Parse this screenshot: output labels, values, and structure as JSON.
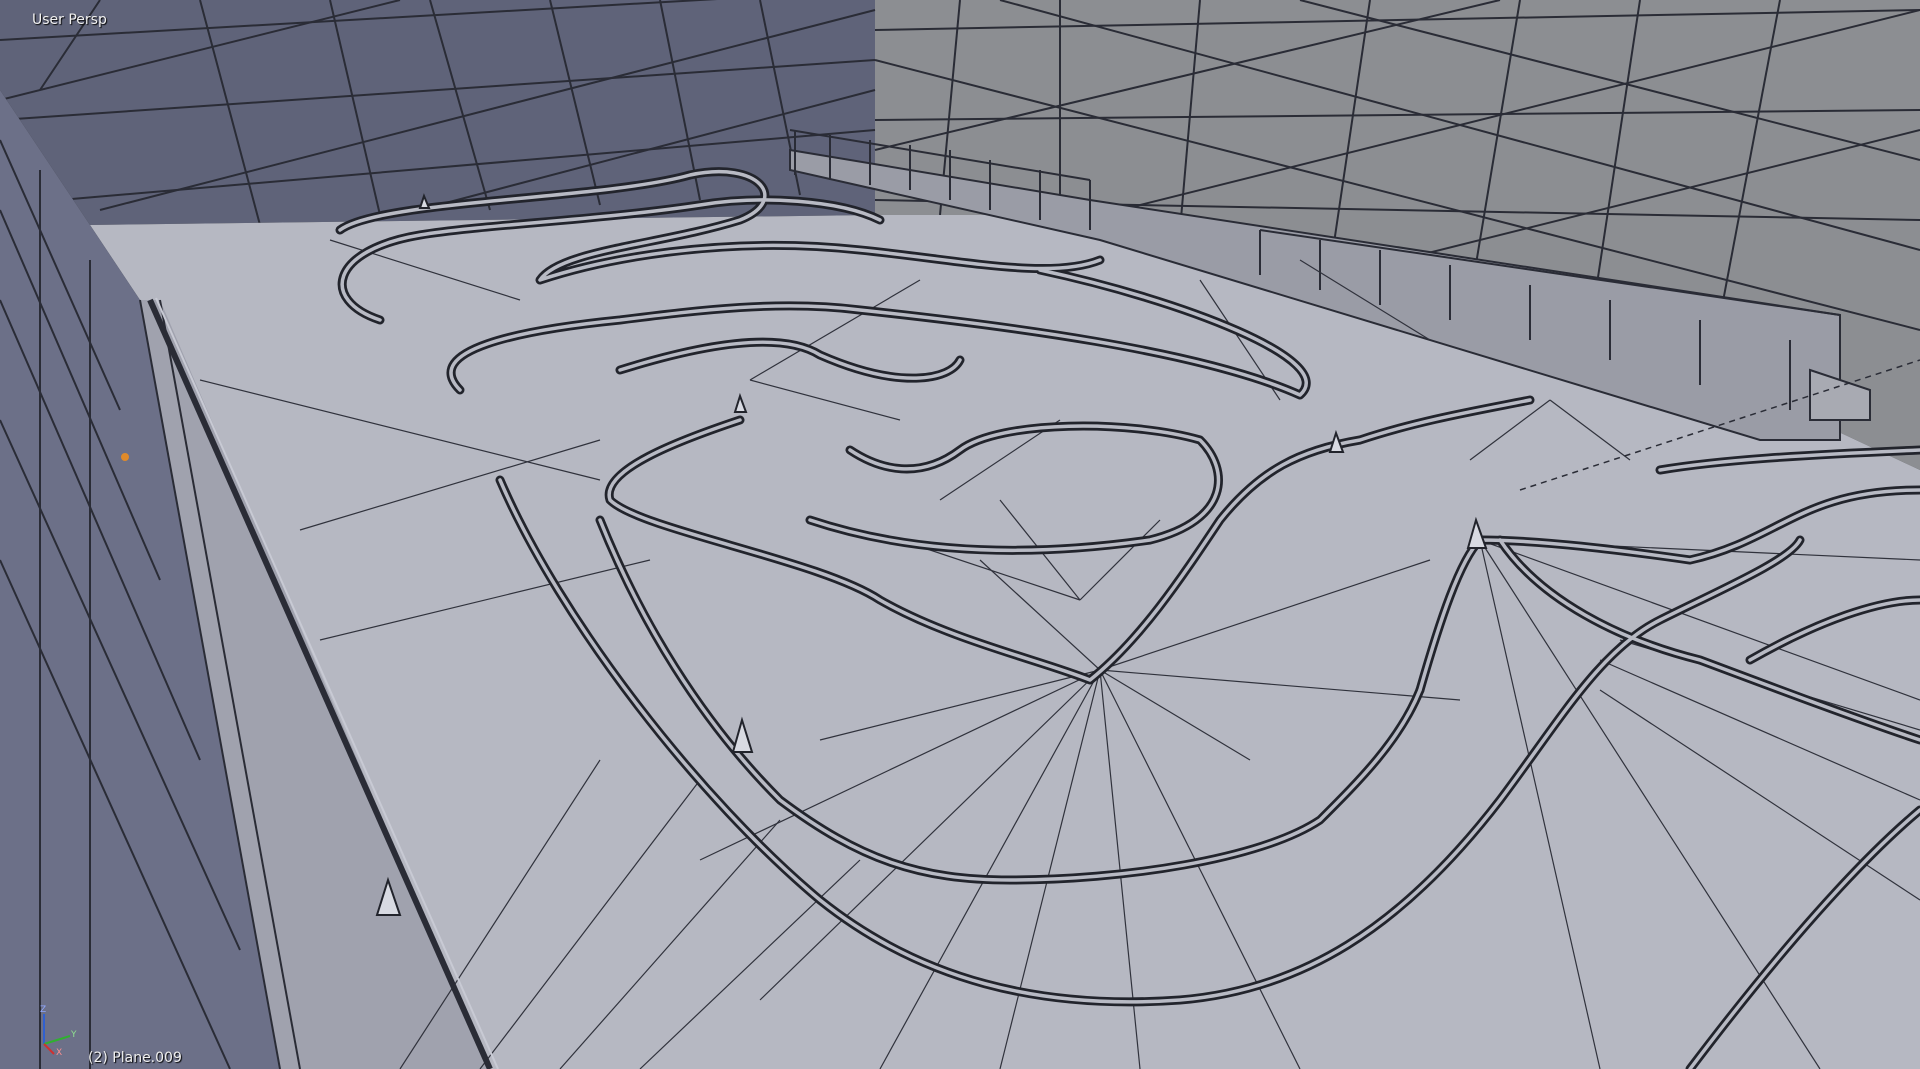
{
  "viewport": {
    "view_name": "User Persp",
    "object_info": "(2) Plane.009",
    "axis_gizmo_icon": "xyz-axis-gizmo-icon",
    "axis_labels": {
      "z": "Z",
      "y": "Y",
      "x": "X"
    },
    "colors": {
      "floor": "#b4b6c0",
      "floor_shade": "#a2a4b0",
      "wall_left": "#5e6278",
      "wall_right": "#8e9094",
      "wire": "#1e2028",
      "selected_vertex": "#e08a2a",
      "axis_x": "#d03030",
      "axis_y": "#30b030",
      "axis_z": "#3060d0"
    }
  }
}
